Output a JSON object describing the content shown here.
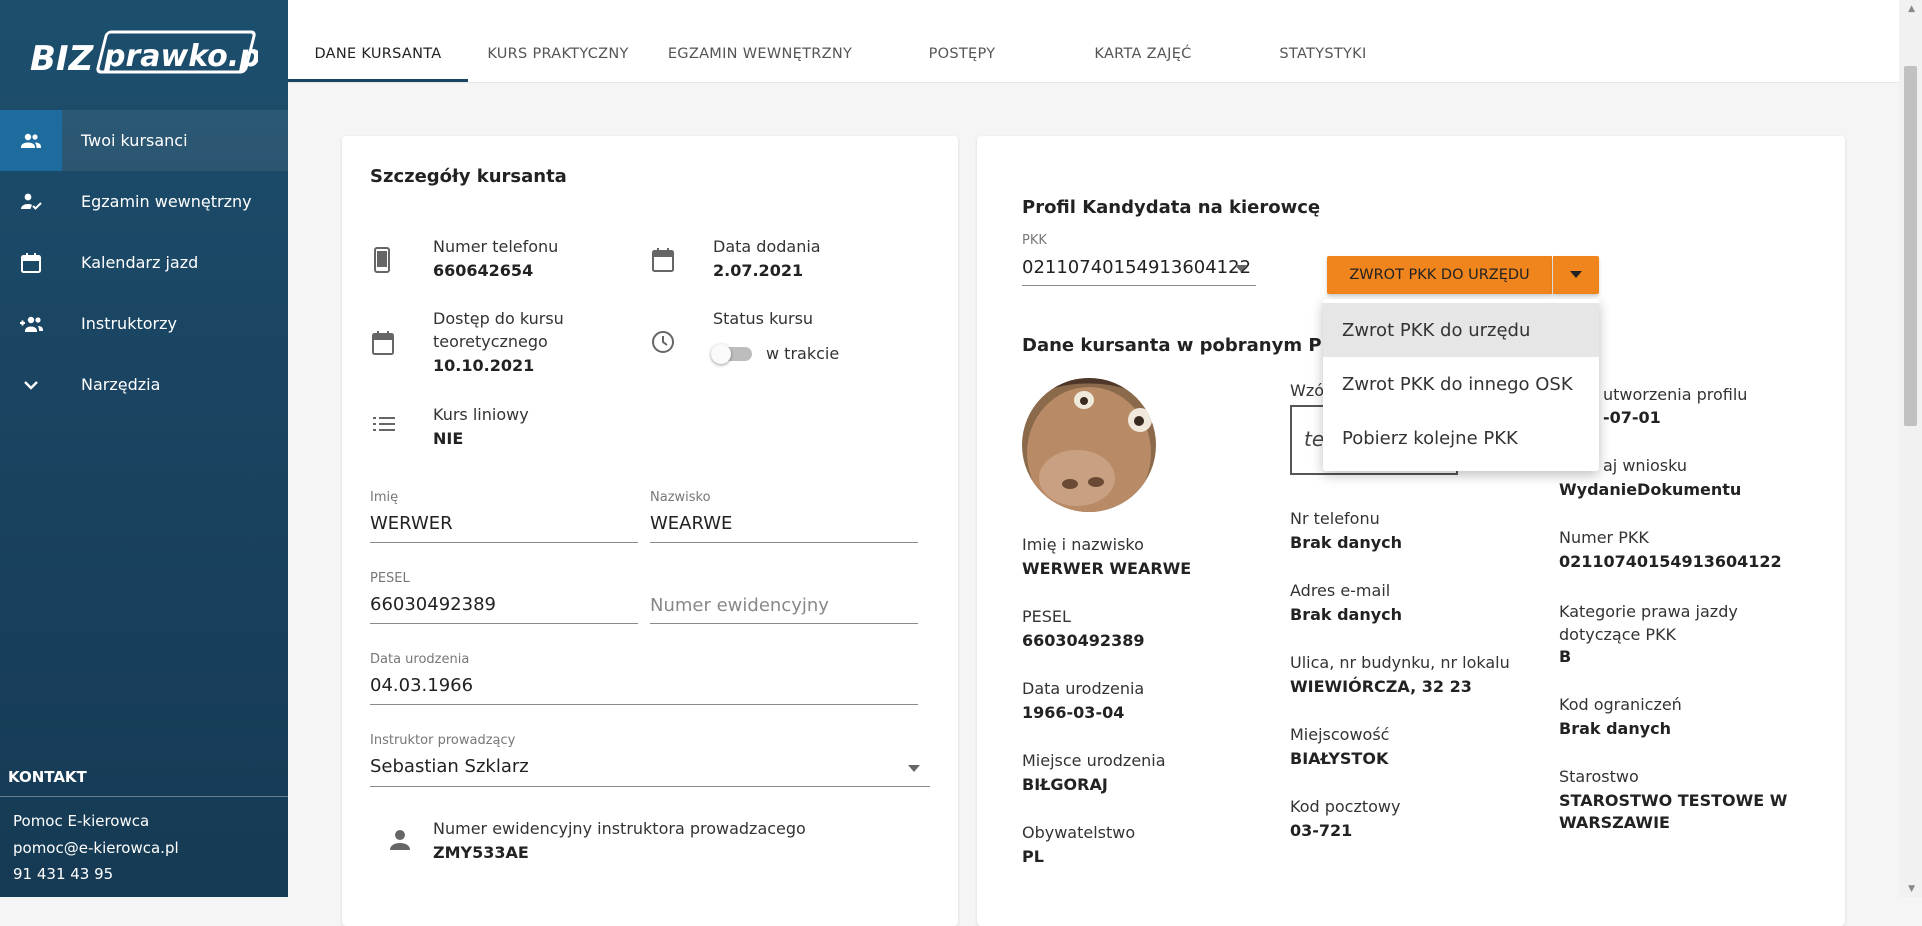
{
  "brand": {
    "part1": "BIZ",
    "part2": "prawko.pl"
  },
  "sidebar": {
    "items": [
      {
        "label": "Twoi kursanci",
        "icon": "people-icon"
      },
      {
        "label": "Egzamin wewnętrzny",
        "icon": "person-check-icon"
      },
      {
        "label": "Kalendarz jazd",
        "icon": "calendar-icon"
      },
      {
        "label": "Instruktorzy",
        "icon": "group-add-icon"
      },
      {
        "label": "Narzędzia",
        "icon": "chevron-down-icon"
      }
    ],
    "contact": {
      "heading": "KONTAKT",
      "name": "Pomoc E-kierowca",
      "email": "pomoc@e-kierowca.pl",
      "phone": "91 431 43 95"
    }
  },
  "tabs": [
    "DANE KURSANTA",
    "KURS PRAKTYCZNY",
    "EGZAMIN WEWNĘTRZNY",
    "POSTĘPY",
    "KARTA ZAJĘĆ",
    "STATYSTYKI"
  ],
  "left": {
    "title": "Szczegóły kursanta",
    "phone_label": "Numer telefonu",
    "phone_value": "660642654",
    "added_label": "Data dodania",
    "added_value": "2.07.2021",
    "access_label_1": "Dostęp do kursu",
    "access_label_2": "teoretycznego",
    "access_value": "10.10.2021",
    "status_label": "Status kursu",
    "status_value": "w trakcie",
    "linear_label": "Kurs liniowy",
    "linear_value": "NIE",
    "first_name_label": "Imię",
    "first_name_value": "WERWER",
    "last_name_label": "Nazwisko",
    "last_name_value": "WEARWE",
    "pesel_label": "PESEL",
    "pesel_value": "66030492389",
    "evidence_placeholder": "Numer ewidencyjny",
    "birth_label": "Data urodzenia",
    "birth_value": "04.03.1966",
    "instructor_label": "Instruktor prowadzący",
    "instructor_value": "Sebastian Szklarz",
    "instr_num_label": "Numer ewidencyjny instruktora prowadzacego",
    "instr_num_value": "ZMY533AE"
  },
  "right": {
    "profile_title": "Profil Kandydata na kierowcę",
    "pkk_label": "PKK",
    "pkk_value": "02110740154913604122",
    "button_label": "ZWROT PKK DO URZĘDU",
    "menu": [
      "Zwrot PKK do urzędu",
      "Zwrot PKK do innego OSK",
      "Pobierz kolejne PKK"
    ],
    "section_title_visible": "Dane kursanta w pobranym PKK",
    "col1": [
      {
        "label": "Imię i nazwisko",
        "value": "WERWER WEARWE"
      },
      {
        "label": "PESEL",
        "value": "66030492389"
      },
      {
        "label": "Data urodzenia",
        "value": "1966-03-04"
      },
      {
        "label": "Miejsce urodzenia",
        "value": "BIŁGORAJ"
      },
      {
        "label": "Obywatelstwo",
        "value": "PL"
      }
    ],
    "signature_label_visible": "Wzó",
    "signature_text_visible": "te",
    "col2": [
      {
        "label": "Nr telefonu",
        "value": "Brak danych"
      },
      {
        "label": "Adres e-mail",
        "value": "Brak danych"
      },
      {
        "label": "Ulica, nr budynku, nr lokalu",
        "value": "WIEWIÓRCZA, 32 23"
      },
      {
        "label": "Miejscowość",
        "value": "BIAŁYSTOK"
      },
      {
        "label": "Kod pocztowy",
        "value": "03-721"
      }
    ],
    "col3_top_label_visible": "utworzenia profilu",
    "col3_top_value_visible": "-07-01",
    "col3_second_label_visible": "aj wniosku",
    "col3_second_value": "WydanieDokumentu",
    "col3": [
      {
        "label": "Numer PKK",
        "value": "02110740154913604122"
      },
      {
        "label": "Kategorie prawa jazdy dotyczące PKK",
        "value": "B"
      },
      {
        "label": "Kod ograniczeń",
        "value": "Brak danych"
      }
    ],
    "starostwo_label": "Starostwo",
    "starostwo_value_1": "STAROSTWO TESTOWE W",
    "starostwo_value_2": "WARSZAWIE"
  }
}
